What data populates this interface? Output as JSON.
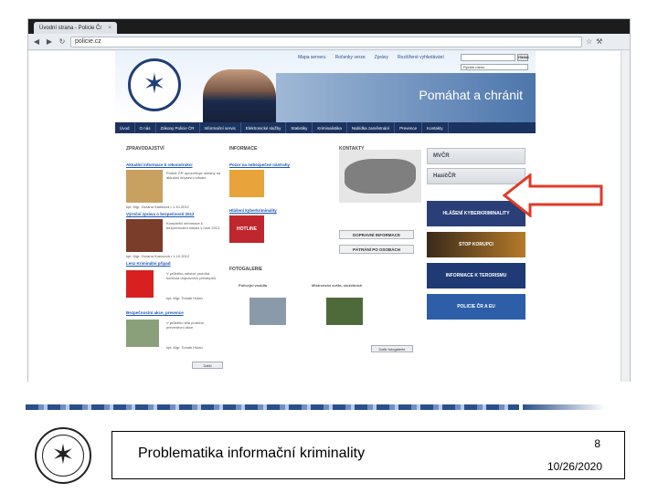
{
  "browser": {
    "tab_title": "Úvodní strana - Policie Čr",
    "tab_close": "×",
    "url": "policie.cz"
  },
  "site": {
    "top_links": [
      "Mapa serveru",
      "Ročenky verze",
      "Zprávy",
      "Rozšířené vyhledávání"
    ],
    "search_button": "Hledat",
    "lang_select": "Rychlé menu",
    "slogan": "Pomáhat a chránit",
    "nav_items": [
      "Úvod",
      "O nás",
      "Zákony Policie ČR",
      "Informační servis",
      "Elektronické služby",
      "Statistiky",
      "Kriminalistika",
      "Nabídka zaměstnání",
      "Prevence",
      "Kontakty"
    ],
    "col_news": "ZPRAVODAJSTVÍ",
    "col_info": "INFORMACE",
    "col_contacts": "KONTAKTY",
    "news": [
      {
        "title": "Aktuální informace k rekonstrukcí",
        "text": "Policie ČR upozorňuje občany na aktuální dopravní situaci.",
        "author": "kpt. Mgr. Zuzana Stašková • 1.10.2012"
      },
      {
        "title": "Výroční zpráva o bezpečnosti 2012",
        "text": "Kompletní informace k bezpečnostní situaci v roce 2012.",
        "author": "kpt. Mgr. Zuzana Krausová • 1.10.2012"
      },
      {
        "title": "Lenz Kriminální případ",
        "text": "V průběhu měsíce probíhá kontrola dopravních přestupků.",
        "author": "kpt. Mgr. Tomáš Hulan"
      },
      {
        "title": "Bezpečnostní akce, prevence",
        "text": "V průběhu léta probíhá preventivní akce.",
        "author": "kpt. Mgr. Tomáš Hulan"
      }
    ],
    "info_links": [
      "Pozor na nebezpečné nástrahy",
      "Hlášení kyberkriminality"
    ],
    "info_hotline": "HOTLINE",
    "fotogalerie": "FOTOGALERIE",
    "photos": [
      "Policejní vozidla",
      "Mistrovství světa, služebních"
    ],
    "more_btn": "Další",
    "more_photos_btn": "Další fotogalerie",
    "side_buttons": [
      "DOPRAVNÍ INFORMACE",
      "PÁTRÁNÍ PO OSOBÁCH"
    ],
    "right_buttons": [
      "MVČR",
      "HasičČR"
    ],
    "blue_buttons": [
      "HLÁŠENÍ KYBERKRIMINALITY",
      "STOP KORUPCI",
      "INFORMACE K TERORISMU",
      "POLICIE ČR A EU"
    ]
  },
  "colors": {
    "accent": "#1b3360",
    "arrow": "#e03a2a"
  },
  "footer": {
    "title": "Problematika informační kriminality",
    "page_number": "8",
    "date": "10/26/2020"
  }
}
